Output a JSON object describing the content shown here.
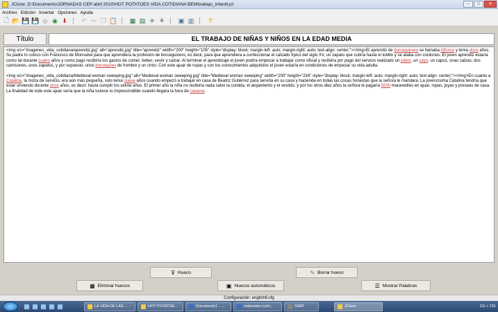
{
  "window": {
    "title": "JCloze: D:\\Documents\\JORNADAS CEP abril 2010\\HOT POTATOES VIDA COTIDIANA BEM\\trabajo_infantil.jcl",
    "buttons": {
      "minimize": "–",
      "maximize": "□",
      "close": "✕"
    }
  },
  "menu": [
    "Archivo",
    "Edición",
    "Insertar",
    "Opciones",
    "Ayuda"
  ],
  "title_row": {
    "label": "Título",
    "value": "EL TRABAJO DE NIÑAS Y NIÑOS EN LA EDAD MEDIA"
  },
  "body": {
    "p1": [
      {
        "t": "<img src=\"imagenes_vida_cotidiana/aprendiz.jpg\" alt=\"aprendiz.jpg\" title=\"aprendiz\" width=\"200\" height=\"105\" style=\"display: block; margin-left: auto; margin-right: auto; text-align: center;\"></img>El aprendiz de "
      },
      {
        "g": "borceguinero"
      },
      {
        "t": " se llamaba "
      },
      {
        "g": "Alfonso"
      },
      {
        "t": " y tenía "
      },
      {
        "g": "doce"
      },
      {
        "t": " años. Su padre lo colocó con Francisco de Monsalve para que aprendiera la profesión de borceguinero, es decir, para que aprendiera a confeccionar el calzado típico del siglo XV, un zapato que cubría hasta el tobillo y se ataba con cordones. El joven aprendiz estaría como tal durante "
      },
      {
        "g": "cuatro"
      },
      {
        "t": " años y como pago recibiría los gastos de comer, beber, vestir y calzar. Al terminar el aprendizaje el joven podría empezar a trabajar como oficial y recibiría por pago del servicio realizado un "
      },
      {
        "g": "jubón"
      },
      {
        "t": ", un "
      },
      {
        "g": "sayo"
      },
      {
        "t": ", un capuz, unas calzas, dos camisones, unos zapatos, y por supuesto, unos "
      },
      {
        "g": "borceguíes"
      },
      {
        "t": " de hombre y un cinto. Con este ajuar de ropas y con los conocimientos adquiridos el joven estaría en condiciones de empezar su vida adulta."
      }
    ],
    "p2": [
      {
        "t": "<img src=\"imagenes_vida_cotidiana/Medieval woman sweeping.jpg\" alt=\"Medieval woman sweeping.jpg\" title=\"Medieval woman sweeping\" width=\"200\" height=\"234\" style=\"display: block; margin-left: auto; margin-right: auto; text-align: center;\"></img>En cuanto a "
      },
      {
        "g": "Catalina"
      },
      {
        "t": ", la moza de servicio, era aún más pequeña, solo tenía "
      },
      {
        "g": "nueve"
      },
      {
        "t": " años cuando empezó a trabajar en casa de Beatriz Gutiérrez para servirla en su casa y hacienda en todas las cosas honestas que la señora le mandara. La jovencísima Catalina tendría que estar sirviendo durante "
      },
      {
        "g": "once"
      },
      {
        "t": " años, es decir, hasta cumplir los veinte años. El primer año la niña no recibiría nada salvo la comida, el alojamiento y el vestido, y por los otros diez años la señora le pagaría "
      },
      {
        "g": "5000"
      },
      {
        "t": " maravedíes en ajuar, ropas, joyas y preseas de casa. La finalidad de todo este ajuar sería que la niña tuviese lo imprescindible cuando llegara la hora de "
      },
      {
        "g": "casarse"
      },
      {
        "t": "."
      }
    ]
  },
  "buttons": {
    "gap": "Hueco",
    "delete_gap": "Borrar hueco",
    "clear_gaps": "Eliminar huecos",
    "auto_gaps": "Huecos automáticos",
    "show_words": "Mostrar Palabras"
  },
  "status": "Configuración: english6.cfg",
  "taskbar": {
    "tasks": [
      "LA VIDA DE LAS...",
      "HOT POTATOE...",
      "Documento1 - ...",
      "materiales curri...",
      "GIMP",
      "JCloze"
    ],
    "tray": "ES  <  191"
  }
}
